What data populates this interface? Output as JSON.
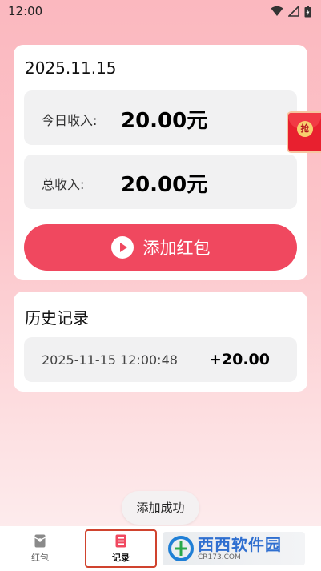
{
  "status_bar": {
    "time": "12:00"
  },
  "summary": {
    "date": "2025.11.15",
    "today_label": "今日收入:",
    "today_value": "20.00元",
    "total_label": "总收入:",
    "total_value": "20.00元",
    "add_button_label": "添加红包"
  },
  "floating_button": {
    "seal_text": "抢"
  },
  "history": {
    "title": "历史记录",
    "records": [
      {
        "time": "2025-11-15 12:00:48",
        "amount": "+20.00"
      }
    ]
  },
  "toast": {
    "text": "添加成功"
  },
  "bottom_nav": {
    "items": [
      {
        "label": "红包",
        "icon": "redpacket-icon",
        "active": false
      },
      {
        "label": "记录",
        "icon": "records-icon",
        "active": true
      }
    ]
  },
  "watermark": {
    "main": "西西软件园",
    "sub": "CR173.COM"
  },
  "colors": {
    "accent": "#f0485f",
    "background": "#fcc5ca",
    "card": "#ffffff",
    "box": "#f1f1f2"
  }
}
